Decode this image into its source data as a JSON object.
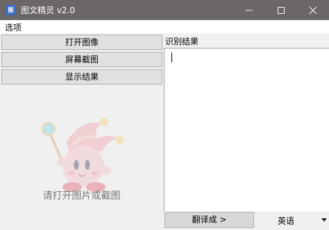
{
  "window": {
    "title": "图文精灵 v2.0",
    "icon_label": "图",
    "controls": [
      "minimize-icon",
      "maximize-icon",
      "close-icon"
    ]
  },
  "menu": {
    "items": [
      "选项"
    ]
  },
  "left": {
    "buttons": {
      "open_image": "打开图像",
      "screen_capture": "屏幕截图",
      "show_result": "显示结果"
    },
    "placeholder": "请打开图片或截图"
  },
  "right": {
    "result_label": "识别结果",
    "result_text": "",
    "translate_button": "翻译成 >",
    "target_language": "英语"
  },
  "colors": {
    "titlebar": "#6b6766",
    "button_face": "#e1e1e1",
    "panel": "#f0f0f0"
  }
}
